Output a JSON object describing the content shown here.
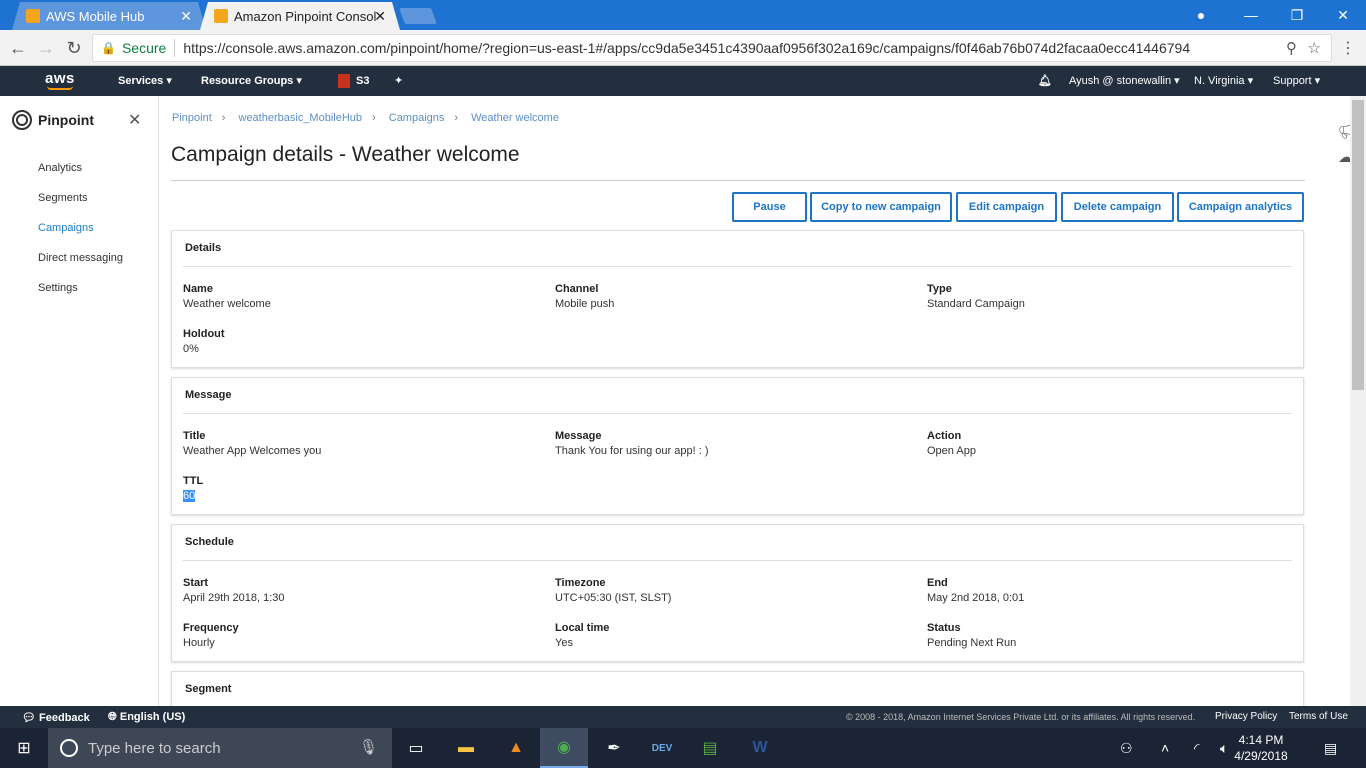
{
  "browser": {
    "tabs": [
      {
        "label": "AWS Mobile Hub",
        "close": "✕"
      },
      {
        "label": "Amazon Pinpoint Consol",
        "close": "✕"
      }
    ],
    "secure_label": "Secure",
    "url": "https://console.aws.amazon.com/pinpoint/home/?region=us-east-1#/apps/cc9da5e3451c4390aaf0956f302a169c/campaigns/f0f46ab76b074d2facaa0ecc41446794"
  },
  "aws_nav": {
    "logo": "aws",
    "services": "Services",
    "resource_groups": "Resource Groups",
    "s3": "S3",
    "account": "Ayush @ stonewallin",
    "region": "N. Virginia",
    "support": "Support"
  },
  "sidebar": {
    "title": "Pinpoint",
    "items": [
      "Analytics",
      "Segments",
      "Campaigns",
      "Direct messaging",
      "Settings"
    ],
    "active": "Campaigns"
  },
  "breadcrumb": [
    "Pinpoint",
    "weatherbasic_MobileHub",
    "Campaigns",
    "Weather welcome"
  ],
  "page_title": "Campaign details - Weather welcome",
  "actions": [
    "Pause",
    "Copy to new campaign",
    "Edit campaign",
    "Delete campaign",
    "Campaign analytics"
  ],
  "details": {
    "header": "Details",
    "name_label": "Name",
    "name": "Weather welcome",
    "channel_label": "Channel",
    "channel": "Mobile push",
    "type_label": "Type",
    "type": "Standard Campaign",
    "holdout_label": "Holdout",
    "holdout": "0%"
  },
  "message": {
    "header": "Message",
    "title_label": "Title",
    "title": "Weather App Welcomes you",
    "message_label": "Message",
    "message": "Thank You for using our app! : )",
    "action_label": "Action",
    "action": "Open App",
    "ttl_label": "TTL",
    "ttl": "60"
  },
  "schedule": {
    "header": "Schedule",
    "start_label": "Start",
    "start": "April 29th 2018, 1:30",
    "timezone_label": "Timezone",
    "timezone": "UTC+05:30 (IST, SLST)",
    "end_label": "End",
    "end": "May 2nd 2018, 0:01",
    "frequency_label": "Frequency",
    "frequency": "Hourly",
    "localtime_label": "Local time",
    "localtime": "Yes",
    "status_label": "Status",
    "status": "Pending Next Run"
  },
  "segment": {
    "header": "Segment"
  },
  "footer": {
    "feedback": "Feedback",
    "language": "English (US)",
    "copyright": "© 2008 - 2018, Amazon Internet Services Private Ltd. or its affiliates. All rights reserved.",
    "privacy": "Privacy Policy",
    "terms": "Terms of Use"
  },
  "taskbar": {
    "search_placeholder": "Type here to search",
    "time": "4:14 PM",
    "date": "4/29/2018"
  }
}
